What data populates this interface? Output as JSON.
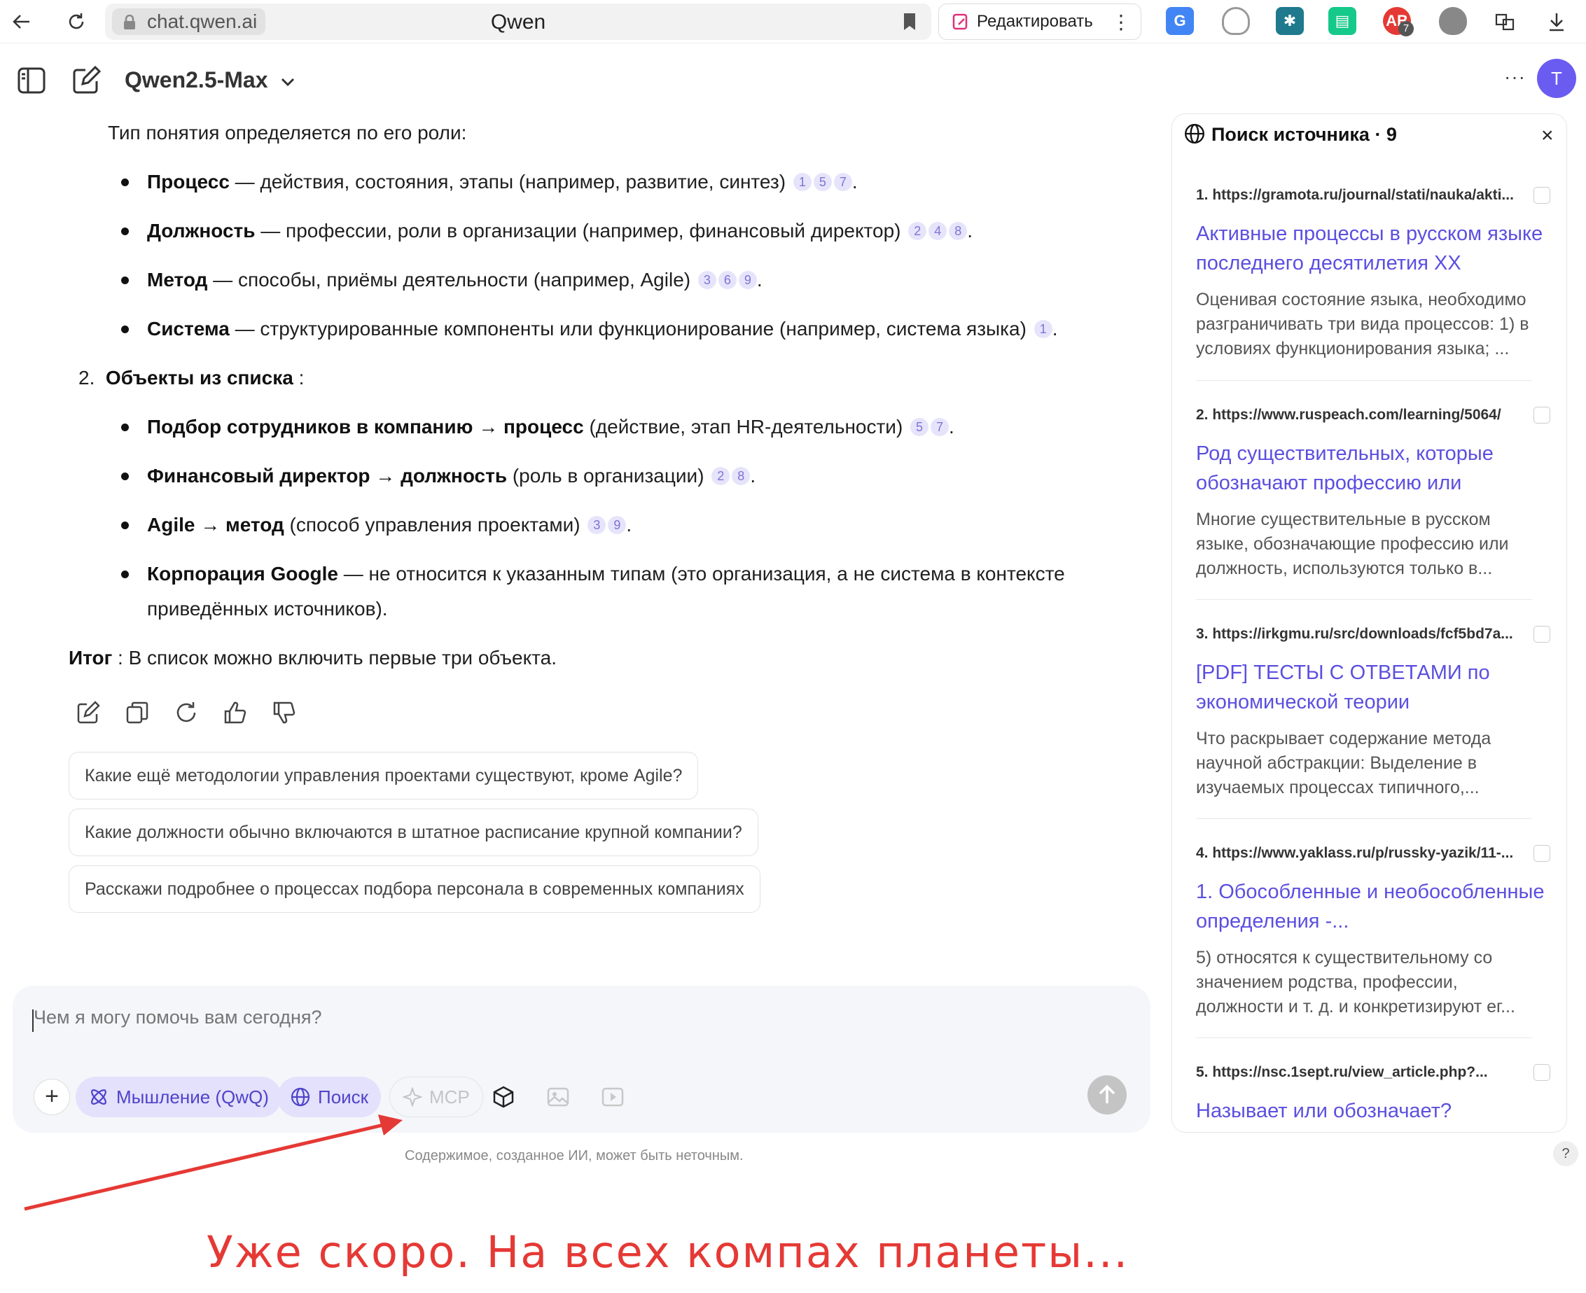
{
  "browser": {
    "url": "chat.qwen.ai",
    "tab_title": "Qwen",
    "edit_label": "Редактировать",
    "ext_badge": "7"
  },
  "header": {
    "model_name": "Qwen2.5-Max",
    "avatar_letter": "T"
  },
  "chat": {
    "intro": "Тип понятия определяется по его роли:",
    "types": [
      {
        "term": "Процесс",
        "desc": " — действия, состояния, этапы (например, развитие, синтез)",
        "cites": [
          "1",
          "5",
          "7"
        ]
      },
      {
        "term": "Должность",
        "desc": " — профессии, роли в организации (например, финансовый директор)",
        "cites": [
          "2",
          "4",
          "8"
        ]
      },
      {
        "term": "Метод",
        "desc": " — способы, приёмы деятельности (например, Agile)",
        "cites": [
          "3",
          "6",
          "9"
        ]
      },
      {
        "term": "Система",
        "desc": " — структурированные компоненты или функционирование (например, система языка)",
        "cites": [
          "1"
        ]
      }
    ],
    "section2_num": "2.",
    "section2_title": "Объекты из списка",
    "section2_colon": " :",
    "objects": [
      {
        "term": "Подбор сотрудников в компанию → процесс",
        "desc": " (действие, этап HR-деятельности)",
        "cites": [
          "5",
          "7"
        ]
      },
      {
        "term": "Финансовый директор → должность",
        "desc": " (роль в организации)",
        "cites": [
          "2",
          "8"
        ]
      },
      {
        "term": "Agile → метод",
        "desc": " (способ управления проектами)",
        "cites": [
          "3",
          "9"
        ]
      },
      {
        "term": "Корпорация Google",
        "desc": " — не относится к указанным типам (это организация, а не система в контексте",
        "cont": "приведённых источников).",
        "cites": []
      }
    ],
    "summary_term": "Итог",
    "summary_text": " : В список можно включить первые три объекта.",
    "suggestions": [
      "Какие ещё методологии управления проектами существуют, кроме Agile?",
      "Какие должности обычно включаются в штатное расписание крупной компании?",
      "Расскажи подробнее о процессах подбора персонала в современных компаниях"
    ]
  },
  "composer": {
    "placeholder": "Чем я могу помочь вам сегодня?",
    "thinking_label": "Мышление (QwQ)",
    "search_label": "Поиск",
    "mcp_label": "MCP",
    "disclaimer": "Содержимое, созданное ИИ, может быть неточным."
  },
  "sources": {
    "title": "Поиск источника · 9",
    "items": [
      {
        "num": "1.",
        "url": "https://gramota.ru/journal/stati/nauka/akti...",
        "title": "Активные процессы в русском языке последнего десятилетия XX",
        "snippet": "Оценивая состояние языка, необходимо разграничивать три вида процессов: 1) в условиях функционирования языка; ..."
      },
      {
        "num": "2.",
        "url": "https://www.ruspeach.com/learning/5064/",
        "title": "Род существительных, которые обозначают профессию или",
        "snippet": "Многие существительные в русском языке, обозначающие профессию или должность, используются только в..."
      },
      {
        "num": "3.",
        "url": "https://irkgmu.ru/src/downloads/fcf5bd7a...",
        "title": "[PDF] ТЕСТЫ С ОТВЕТАМИ по экономической теории",
        "snippet": "Что раскрывает содержание метода научной абстракции: Выделение в изучаемых процессах типичного,..."
      },
      {
        "num": "4.",
        "url": "https://www.yaklass.ru/p/russky-yazik/11-...",
        "title": "1. Обособленные и необособленные определения -...",
        "snippet": "5) относятся к существительному со значением родства, профессии, должности и т. д. и конкретизируют ег..."
      },
      {
        "num": "5.",
        "url": "https://nsc.1sept.ru/view_article.php?...",
        "title": "Называет или обозначает?",
        "snippet": ""
      }
    ]
  },
  "help_label": "?",
  "annotation": "Уже скоро. На всех компах планеты...",
  "colors": {
    "accent": "#5b4fe0",
    "avatar": "#6a5cf0",
    "annotation": "#e53935"
  }
}
